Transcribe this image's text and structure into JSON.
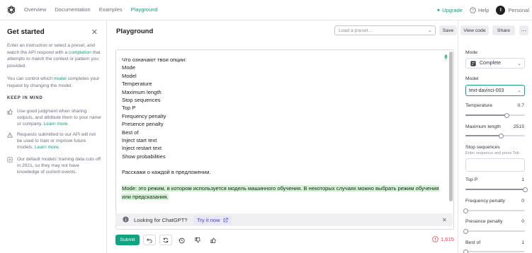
{
  "nav": {
    "links": [
      "Overview",
      "Documentation",
      "Examples",
      "Playground"
    ],
    "active": "Playground",
    "upgrade": "Upgrade",
    "help": "Help",
    "user_initial": "I",
    "user_name": "Personal"
  },
  "sidebar": {
    "title": "Get started",
    "intro_pre": "Enter an instruction or select a preset, and watch the API respond with a",
    "intro_link": "completion",
    "intro_post": "that attempts to match the context or pattern you provided.",
    "control_pre": "You can control which",
    "control_link": "model",
    "control_post": "completes your request by changing the model.",
    "keep_heading": "KEEP IN MIND",
    "items": [
      {
        "icon": "thumbs-up-icon",
        "text": "Use good judgment when sharing outputs, and attribute them to your name or company.",
        "link": "Learn more."
      },
      {
        "icon": "alert-icon",
        "text": "Requests submitted to our API will not be used to train or improve future models.",
        "link": "Learn more."
      },
      {
        "icon": "history-icon",
        "text": "Our default models' training data cuts off in 2021, so they may not have knowledge of current events.",
        "link": ""
      }
    ]
  },
  "main": {
    "title": "Playground",
    "preset_placeholder": "Load a preset...",
    "save": "Save",
    "view_code": "View code",
    "share": "Share",
    "more": "···",
    "prompt_lines": [
      "Что означают твои опции:",
      "Mode",
      "Model",
      "Temperature",
      "Maximum length",
      "Stop sequences",
      "Top P",
      "Frequency penalty",
      "Presence penalty",
      "Best of",
      "Inject start text",
      "Inject restart text",
      "Show probabilities"
    ],
    "prompt_request": "Расскажи о каждой в предложении.",
    "completion_line1": "Mode: это режим, в котором используется модель машинного обучения. В некоторых случаях можно выбрать режим обучения",
    "completion_line2": "или предсказания.",
    "banner_text": "Looking for ChatGPT?",
    "banner_link": "Try it now",
    "submit": "Submit",
    "token_count": "1,615"
  },
  "settings": {
    "mode_label": "Mode",
    "mode_value": "Complete",
    "model_label": "Model",
    "model_value": "text-davinci-003",
    "temperature_label": "Temperature",
    "temperature_value": "0.7",
    "temperature_fraction": 0.7,
    "max_length_label": "Maximum length",
    "max_length_value": "2515",
    "max_length_fraction": 0.6,
    "stop_label": "Stop sequences",
    "stop_hint": "Enter sequence and press Tab",
    "top_p_label": "Top P",
    "top_p_value": "1",
    "top_p_fraction": 1.0,
    "freq_label": "Frequency penalty",
    "freq_value": "0",
    "freq_fraction": 0.0,
    "presence_label": "Presence penalty",
    "presence_value": "0",
    "presence_fraction": 0.0,
    "best_of_label": "Best of",
    "best_of_value": "1",
    "best_of_fraction": 0.0
  },
  "colors": {
    "accent": "#10a37f",
    "highlight": "#d2f4d3",
    "warning": "#ef4146",
    "link_purple": "#5436da"
  }
}
